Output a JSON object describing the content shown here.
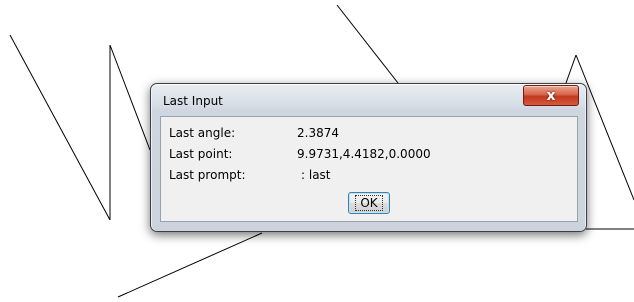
{
  "dialog": {
    "title": "Last Input",
    "close_label": "x",
    "rows": [
      {
        "label": "Last angle:",
        "value": "2.3874"
      },
      {
        "label": "Last point:",
        "value": "9.9731,4.4182,0.0000"
      },
      {
        "label": "Last prompt:",
        "value": ": last"
      }
    ],
    "ok_label": "OK"
  },
  "colors": {
    "drawing_line": "#000000",
    "background": "#ffffff",
    "close_button": "#c7452a"
  }
}
